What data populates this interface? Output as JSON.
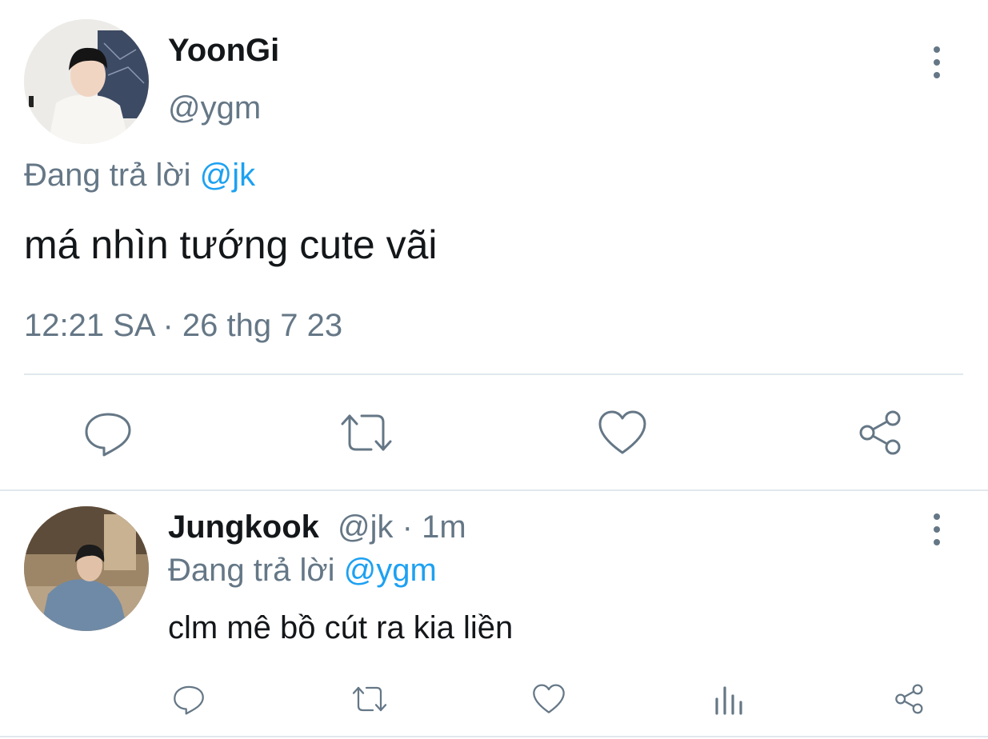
{
  "main_tweet": {
    "display_name": "YoonGi",
    "handle": "@ygm",
    "reply_prefix": "Đang trả lời",
    "reply_to": "@jk",
    "text": "má nhìn tướng cute vãi",
    "timestamp": "12:21 SA · 26 thg 7 23",
    "actions": [
      "reply-icon",
      "retweet-icon",
      "like-icon",
      "share-icon"
    ]
  },
  "reply_tweet": {
    "display_name": "Jungkook",
    "handle_time": "@jk · 1m",
    "reply_prefix": "Đang trả lời",
    "reply_to": "@ygm",
    "text": "clm mê bồ cút ra kia liền",
    "actions": [
      "reply-icon",
      "retweet-icon",
      "like-icon",
      "analytics-icon",
      "share-icon"
    ]
  },
  "colors": {
    "text": "#14171a",
    "muted": "#657786",
    "link": "#1da1f2",
    "divider": "#e1e8ed"
  }
}
